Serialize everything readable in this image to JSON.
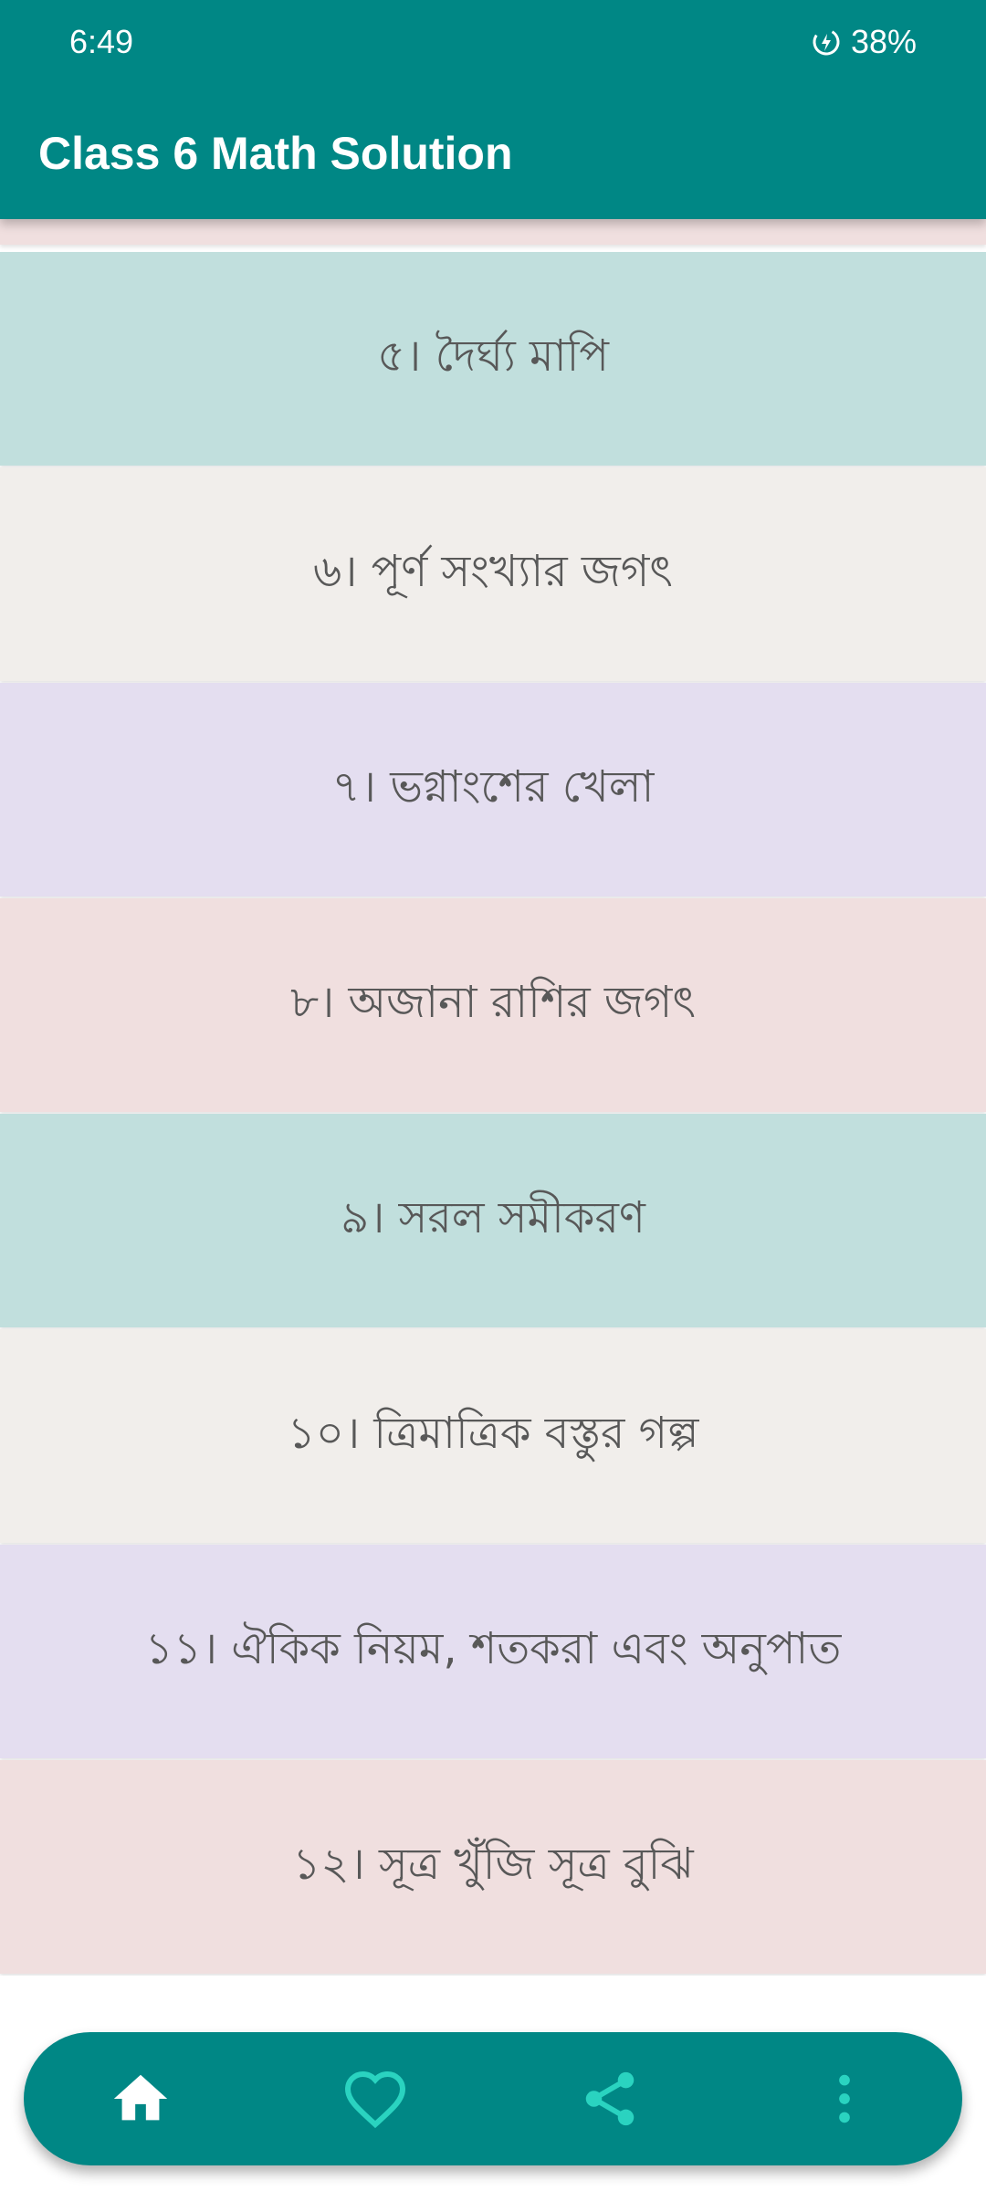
{
  "status_bar": {
    "time": "6:49",
    "battery": "38%"
  },
  "toolbar": {
    "title": "Class 6 Math Solution"
  },
  "chapters": [
    {
      "label": "",
      "color": "#f0dfdf"
    },
    {
      "label": "৫। দৈর্ঘ্য মাপি",
      "color": "#c1dfdd"
    },
    {
      "label": "৬। পূর্ণ সংখ্যার জগৎ",
      "color": "#f1eeeb"
    },
    {
      "label": "৭। ভগ্নাংশের খেলা",
      "color": "#e4def0"
    },
    {
      "label": "৮। অজানা রাশির জগৎ",
      "color": "#f0dfdf"
    },
    {
      "label": "৯। সরল সমীকরণ",
      "color": "#c1dfdd"
    },
    {
      "label": "১০। ত্রিমাত্রিক বস্তুর গল্প",
      "color": "#f1eeeb"
    },
    {
      "label": "১১। ঐকিক নিয়ম, শতকরা এবং অনুপাত",
      "color": "#e4def0"
    },
    {
      "label": "১২। সূত্র খুঁজি সূত্র বুঝি",
      "color": "#f0dfdf"
    }
  ],
  "bottom_nav": {
    "icons": [
      "home-icon",
      "heart-icon",
      "share-icon",
      "more-vert-icon"
    ],
    "accent": "#008785",
    "home_color": "#ffffff",
    "other_color": "#2ad3c0"
  }
}
